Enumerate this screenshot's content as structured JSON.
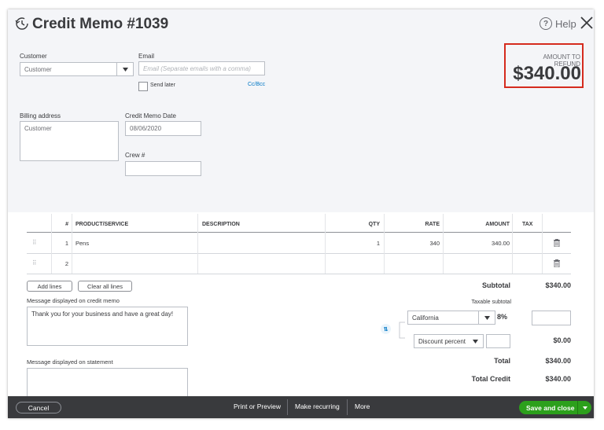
{
  "header": {
    "title": "Credit Memo #1039",
    "help_label": "Help",
    "help_glyph": "?"
  },
  "customer": {
    "label": "Customer",
    "value": "Customer"
  },
  "email": {
    "label": "Email",
    "placeholder": "Email (Separate emails with a comma)",
    "send_later_label": "Send later",
    "cc_bcc_label": "Cc/Bcc"
  },
  "refund": {
    "label": "AMOUNT TO REFUND",
    "value": "$340.00"
  },
  "billing": {
    "label": "Billing address",
    "value": "Customer"
  },
  "memo_date": {
    "label": "Credit Memo Date",
    "value": "08/06/2020"
  },
  "crew": {
    "label": "Crew #",
    "value": ""
  },
  "table": {
    "headers": [
      "#",
      "PRODUCT/SERVICE",
      "DESCRIPTION",
      "QTY",
      "RATE",
      "AMOUNT",
      "TAX"
    ],
    "rows": [
      {
        "num": "1",
        "product": "Pens",
        "description": "",
        "qty": "1",
        "rate": "340",
        "amount": "340.00"
      },
      {
        "num": "2",
        "product": "",
        "description": "",
        "qty": "",
        "rate": "",
        "amount": ""
      }
    ]
  },
  "actions": {
    "add_lines": "Add lines",
    "clear_lines": "Clear all lines"
  },
  "message_memo": {
    "label": "Message displayed on credit memo",
    "value": "Thank you for your business and have a great day!"
  },
  "message_statement": {
    "label": "Message displayed on statement",
    "value": ""
  },
  "totals": {
    "subtotal_label": "Subtotal",
    "subtotal_value": "$340.00",
    "taxable_label": "Taxable subtotal",
    "tax_region": "California",
    "tax_rate": "8%",
    "discount_type": "Discount percent",
    "discount_value": "$0.00",
    "total_label": "Total",
    "total_value": "$340.00",
    "total_credit_label": "Total Credit",
    "total_credit_value": "$340.00"
  },
  "footer": {
    "cancel": "Cancel",
    "print_preview": "Print or Preview",
    "make_recurring": "Make recurring",
    "more": "More",
    "save_close": "Save and close"
  },
  "colors": {
    "accent_green": "#2ca01c",
    "highlight_red": "#d52b1e",
    "footer_dark": "#393a3d",
    "link_blue": "#0077c5"
  }
}
